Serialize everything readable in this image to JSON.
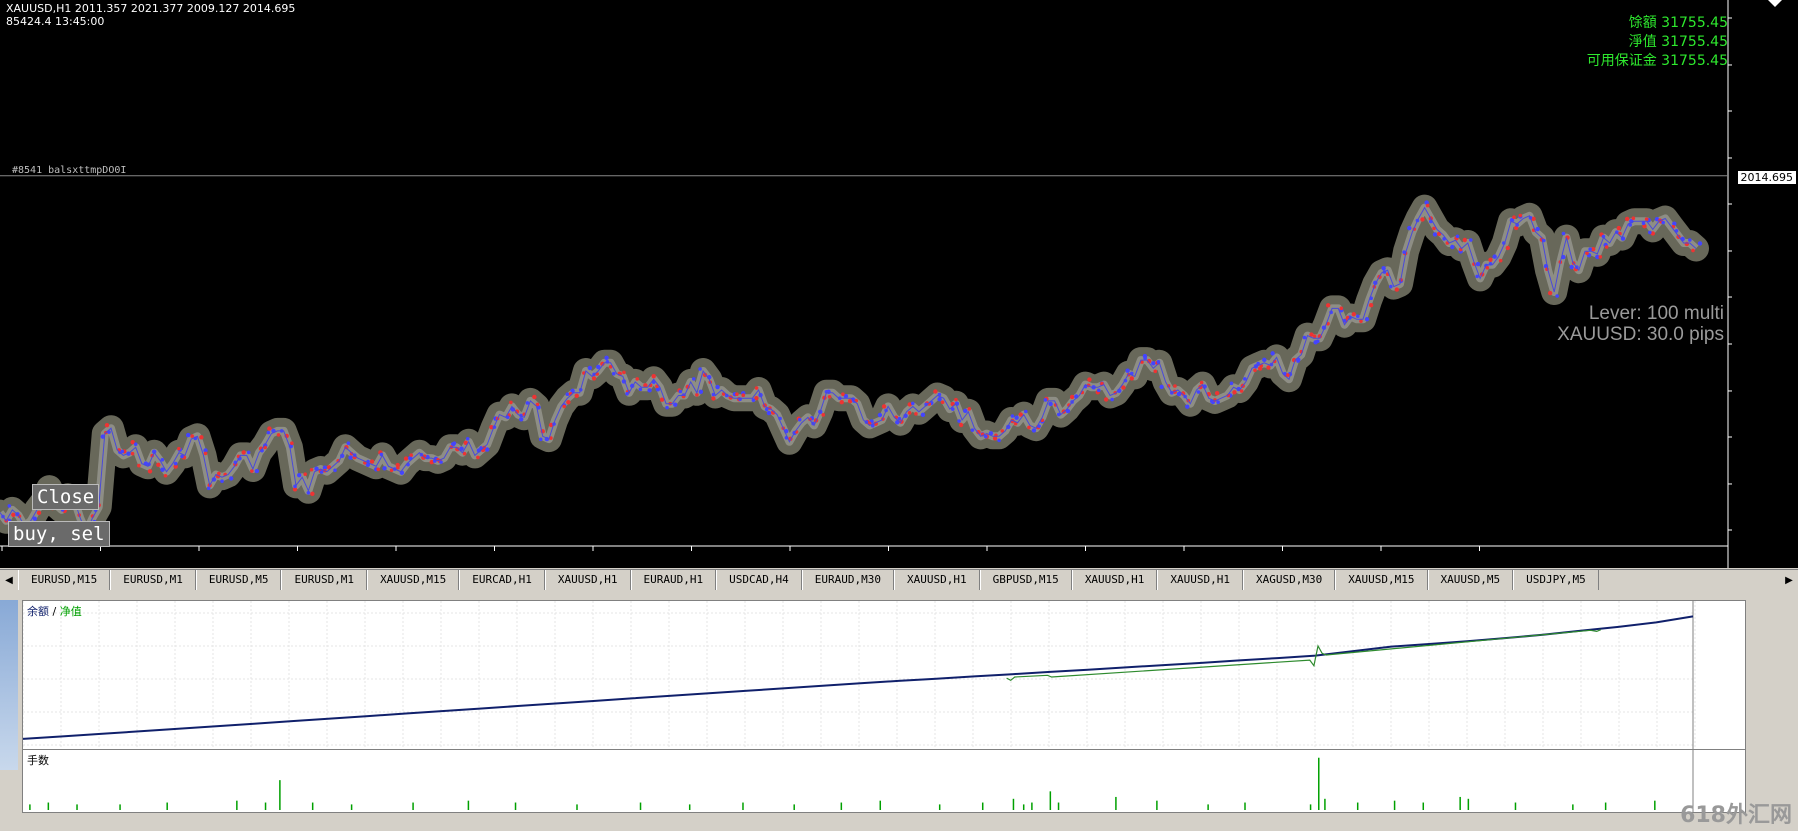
{
  "chart_header": {
    "line1": "XAUUSD,H1  2011.357 2021.377 2009.127 2014.695",
    "line2": "85424.4    13:45:00"
  },
  "account": {
    "balance": "馀額 31755.45",
    "equity": "淨值 31755.45",
    "free_margin": "可用保证金 31755.45"
  },
  "lever": "Lever: 100 multi",
  "spread": "XAUUSD: 30.0 pips",
  "order_label": "#8541 balsxttmpDO0I",
  "buttons": {
    "close": "Close",
    "buy_sell": "buy, sel"
  },
  "current_price": "2014.695",
  "colors": {
    "price_line": "#4a4ad8",
    "buy_marker": "#e33",
    "sell_marker": "#44f",
    "equity_line": "#10206b",
    "volume_bar": "#00a000",
    "account_text": "#2ee82e"
  },
  "chart_data": [
    {
      "type": "line",
      "title": "",
      "symbol": "XAUUSD,H1",
      "y_ticks": [
        "2072.630",
        "2055.380",
        "2038.475",
        "2021.225",
        "2004.320",
        "1987.070",
        "1970.165",
        "1952.915",
        "1935.665",
        "1918.760",
        "1901.510",
        "1884.605"
      ],
      "ylim": [
        1884.605,
        2072.63
      ],
      "x_ticks": [
        "25 Feb 2022",
        "28 Feb 04:00",
        "28 Feb 16:00",
        "1 Mar 05:00",
        "1 Mar 17:00",
        "2 Mar 06:00",
        "2 Mar 18:00",
        "3 Mar 07:00",
        "3 Mar 19:00",
        "4 Mar 08:00",
        "4 Mar 20:00",
        "7 Mar 09:00",
        "7 Mar 21:00",
        "8 Mar 10:00",
        "8 Mar 22:00",
        "9 Mar 11:00"
      ],
      "x": [
        0,
        5,
        10,
        15,
        20,
        25,
        30,
        35,
        40,
        45,
        50,
        55,
        60,
        65,
        70,
        75,
        80,
        85,
        90,
        95,
        100,
        105,
        110,
        115,
        120,
        125,
        130,
        135,
        140,
        145,
        150,
        155,
        160,
        165,
        170,
        175,
        180,
        185,
        190,
        195,
        200,
        205,
        210,
        215,
        220,
        225,
        230,
        235,
        240,
        245,
        250,
        255,
        260,
        265,
        270,
        275,
        280,
        285,
        290,
        295,
        300,
        305,
        310,
        315,
        320,
        325,
        330,
        335,
        340,
        345,
        350,
        355,
        360,
        365,
        370,
        375,
        380,
        385,
        390,
        395,
        400,
        405,
        410,
        415,
        420,
        425,
        430,
        435,
        440,
        445,
        450,
        455,
        460,
        465,
        470,
        475,
        480,
        485,
        490,
        495,
        500,
        505,
        510,
        515,
        520,
        525,
        530,
        535,
        540,
        545,
        550,
        555,
        560,
        565,
        570,
        575,
        580,
        585,
        590,
        595,
        600,
        605,
        610,
        615,
        620,
        625,
        630,
        635,
        640,
        645,
        650,
        655,
        660,
        665,
        670,
        675,
        680,
        685,
        690,
        695,
        700,
        705,
        710,
        715,
        720,
        725,
        730,
        735,
        740,
        745,
        750,
        755,
        760,
        765,
        770,
        775,
        780,
        785,
        790,
        795,
        800,
        805,
        810,
        815,
        820,
        825,
        830,
        835,
        840,
        845,
        850,
        855,
        860,
        865,
        870,
        875,
        880,
        885,
        890,
        895,
        900,
        905,
        910,
        915,
        920,
        925,
        930,
        935,
        940,
        945,
        950,
        955,
        960,
        965,
        970,
        975,
        980,
        985,
        990,
        995,
        1000,
        1005,
        1010,
        1015,
        1020,
        1025,
        1030,
        1035,
        1040,
        1045,
        1050,
        1055,
        1060,
        1065,
        1070,
        1075,
        1080,
        1085,
        1090,
        1095,
        1100,
        1105,
        1110,
        1115,
        1120,
        1125,
        1130,
        1135,
        1140,
        1145,
        1150,
        1155,
        1160,
        1165,
        1170,
        1175,
        1180,
        1185,
        1190,
        1195,
        1200,
        1205,
        1210,
        1215,
        1220,
        1225,
        1230,
        1235,
        1240,
        1245,
        1250,
        1255,
        1260,
        1265,
        1270,
        1275,
        1280,
        1285,
        1290,
        1295,
        1300,
        1305,
        1310,
        1315,
        1320,
        1325,
        1330,
        1335,
        1340,
        1345,
        1350,
        1355,
        1360,
        1365,
        1370,
        1375
      ],
      "values": [
        1891,
        1888,
        1892,
        1890,
        1886,
        1888,
        1892,
        1895,
        1900,
        1894,
        1892,
        1897,
        1896,
        1889,
        1884,
        1889,
        1893,
        1920,
        1922,
        1914,
        1912,
        1913,
        1915,
        1909,
        1908,
        1913,
        1910,
        1906,
        1909,
        1913,
        1912,
        1918,
        1919,
        1912,
        1901,
        1905,
        1904,
        1905,
        1908,
        1912,
        1912,
        1907,
        1913,
        1916,
        1920,
        1921,
        1921,
        1915,
        1901,
        1904,
        1899,
        1906,
        1907,
        1906,
        1908,
        1910,
        1915,
        1913,
        1911,
        1910,
        1909,
        1908,
        1912,
        1908,
        1907,
        1906,
        1909,
        1911,
        1913,
        1911,
        1911,
        1910,
        1911,
        1915,
        1915,
        1913,
        1917,
        1912,
        1914,
        1916,
        1922,
        1927,
        1926,
        1930,
        1927,
        1926,
        1932,
        1930,
        1919,
        1918,
        1925,
        1930,
        1933,
        1935,
        1935,
        1943,
        1941,
        1943,
        1946,
        1946,
        1942,
        1941,
        1935,
        1939,
        1937,
        1937,
        1940,
        1937,
        1931,
        1931,
        1934,
        1934,
        1939,
        1935,
        1943,
        1940,
        1934,
        1936,
        1934,
        1933,
        1933,
        1933,
        1933,
        1936,
        1930,
        1929,
        1927,
        1922,
        1917,
        1921,
        1924,
        1926,
        1923,
        1928,
        1935,
        1935,
        1933,
        1933,
        1933,
        1931,
        1925,
        1923,
        1924,
        1925,
        1930,
        1926,
        1924,
        1928,
        1930,
        1928,
        1930,
        1932,
        1934,
        1933,
        1929,
        1931,
        1925,
        1928,
        1922,
        1919,
        1920,
        1919,
        1919,
        1921,
        1925,
        1924,
        1927,
        1923,
        1922,
        1926,
        1932,
        1932,
        1927,
        1929,
        1932,
        1934,
        1938,
        1937,
        1937,
        1938,
        1934,
        1935,
        1938,
        1942,
        1941,
        1947,
        1947,
        1944,
        1946,
        1939,
        1935,
        1936,
        1934,
        1931,
        1936,
        1938,
        1933,
        1932,
        1933,
        1934,
        1937,
        1936,
        1939,
        1944,
        1945,
        1946,
        1945,
        1948,
        1942,
        1940,
        1947,
        1949,
        1956,
        1955,
        1955,
        1960,
        1966,
        1966,
        1960,
        1963,
        1962,
        1962,
        1969,
        1975,
        1979,
        1980,
        1974,
        1975,
        1987,
        1994,
        1999,
        2003,
        1999,
        1995,
        1993,
        1990,
        1991,
        1988,
        1990,
        1983,
        1977,
        1982,
        1982,
        1985,
        1990,
        1998,
        1997,
        1999,
        2000,
        1994,
        1992,
        1980,
        1972,
        1983,
        1992,
        1983,
        1980,
        1987,
        1987,
        1986,
        1992,
        1990,
        1994,
        1992,
        1997,
        1998,
        1998,
        1998,
        1995,
        1998,
        1999,
        1996,
        1993,
        1990,
        1990,
        1988,
        1987,
        1990,
        1993,
        1993,
        1998,
        1999,
        1997,
        2000,
        2007,
        2010,
        2010,
        2006,
        2008,
        2012,
        2009,
        2016,
        2013,
        2020,
        2022,
        2024,
        2030,
        2034,
        2050,
        2056,
        2066,
        2072,
        2068,
        2060,
        2040,
        2034,
        2025,
        2030,
        2040,
        2052,
        2053,
        2057,
        2055,
        2050,
        2048,
        2048,
        2046,
        2052,
        2056,
        2053,
        2048,
        2042,
        2036,
        2030,
        2021,
        2018,
        2015,
        2010,
        2014
      ]
    },
    {
      "type": "line",
      "title": "",
      "legend": [
        "余额",
        "净值"
      ],
      "y_ticks": [
        "32367",
        "26502",
        "20638",
        "14774",
        "8910"
      ],
      "ylim": [
        8910,
        32367
      ],
      "x_ticks": [
        "0",
        "203",
        "388",
        "573",
        "758",
        "943",
        "1128",
        "1313",
        "1498",
        "1683",
        "1868",
        "2053",
        "2238",
        "2423",
        "2608",
        "2793",
        "2978",
        "3163",
        "3348",
        "3533",
        "3718",
        "3902",
        "4087",
        "4272",
        "4457",
        "4642",
        "4827",
        "5012",
        "5197",
        "5382",
        "5567",
        "5752",
        "5937",
        "6122",
        "6307",
        "6492",
        "6677",
        "6862",
        "7047",
        "7232",
        "7417",
        "7601",
        "7786",
        "7971",
        "81"
      ],
      "series": [
        {
          "name": "余额",
          "x": [
            0,
            203,
            388,
            573,
            758,
            943,
            1128,
            1313,
            1498,
            1683,
            1868,
            2053,
            2238,
            2423,
            2608,
            2793,
            2978,
            3163,
            3348,
            3533,
            3718,
            3902,
            4087,
            4272,
            4457,
            4642,
            4827,
            5012,
            5197,
            5382,
            5567,
            5752,
            5937,
            6122,
            6307,
            6492,
            6677,
            6862,
            7047,
            7232,
            7417,
            7601,
            7786,
            7971,
            8150
          ],
          "values": [
            10000,
            10450,
            10900,
            11350,
            11800,
            12250,
            12700,
            13150,
            13600,
            14050,
            14500,
            14950,
            15400,
            15850,
            16300,
            16750,
            17200,
            17650,
            18100,
            18550,
            19000,
            19450,
            19900,
            20300,
            20700,
            21100,
            21500,
            21900,
            22300,
            22700,
            23100,
            23500,
            23950,
            24350,
            24800,
            25600,
            26400,
            26850,
            27350,
            27900,
            28500,
            29200,
            29900,
            30700,
            31755
          ]
        },
        {
          "name": "净值",
          "x": [
            4800,
            4820,
            4840,
            5000,
            5020,
            6280,
            6300,
            6320,
            6340,
            6360,
            7650,
            7680,
            7700
          ],
          "values": [
            20800,
            20400,
            21000,
            21300,
            21000,
            24000,
            23000,
            26500,
            25200,
            24900,
            29300,
            29100,
            29400
          ]
        }
      ]
    },
    {
      "type": "bar",
      "title": "",
      "label": "手数",
      "x": [
        30,
        120,
        260,
        470,
        700,
        1040,
        1180,
        1250,
        1410,
        1600,
        1900,
        2170,
        2400,
        2700,
        3010,
        3250,
        3510,
        3760,
        3990,
        4180,
        4470,
        4680,
        4830,
        4880,
        4920,
        5010,
        5050,
        5330,
        5530,
        5780,
        5960,
        6280,
        6320,
        6350,
        6510,
        6690,
        6830,
        7010,
        7050,
        7280,
        7560,
        7720,
        7960
      ],
      "values": [
        0.3,
        0.4,
        0.3,
        0.3,
        0.4,
        0.5,
        0.4,
        1.6,
        0.4,
        0.3,
        0.4,
        0.5,
        0.4,
        0.3,
        0.4,
        0.3,
        0.4,
        0.3,
        0.4,
        0.5,
        0.3,
        0.4,
        0.6,
        0.3,
        0.4,
        1.0,
        0.4,
        0.7,
        0.5,
        0.3,
        0.4,
        0.3,
        2.8,
        0.6,
        0.4,
        0.5,
        0.4,
        0.7,
        0.6,
        0.4,
        0.3,
        0.4,
        0.5
      ]
    }
  ],
  "tabs": [
    "EURUSD,M15",
    "EURUSD,M1",
    "EURUSD,M5",
    "EURUSD,M1",
    "XAUUSD,M15",
    "EURCAD,H1",
    "XAUUSD,H1",
    "EURAUD,H1",
    "USDCAD,H4",
    "EURAUD,M30",
    "XAUUSD,H1",
    "GBPUSD,M15",
    "XAUUSD,H1",
    "XAUUSD,H1",
    "XAGUSD,M30",
    "XAUUSD,M15",
    "XAUUSD,M5",
    "USDJPY,M5"
  ],
  "watermark": "618外汇网"
}
